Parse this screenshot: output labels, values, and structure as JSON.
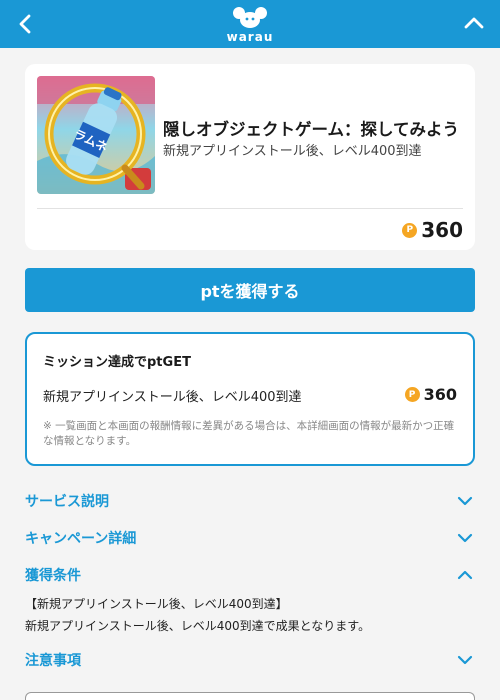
{
  "header": {
    "logo_text": "warau",
    "back_icon": "chevron-left-icon",
    "collapse_icon": "chevron-up-icon",
    "brand_color": "#1a98d5"
  },
  "offer": {
    "title": "隠しオブジェクトゲーム：探してみよう",
    "subtitle": "新規アプリインストール後、レベル400到達",
    "points": "360",
    "coin_symbol": "P",
    "thumbnail_label": "ラムネ"
  },
  "get_button": {
    "label": "ptを獲得する"
  },
  "mission": {
    "title": "ミッション達成でptGET",
    "row_text": "新規アプリインストール後、レベル400到達",
    "points": "360",
    "coin_symbol": "P",
    "note": "※ 一覧画面と本画面の報酬情報に差異がある場合は、本詳細画面の情報が最新かつ正確な情報となります。"
  },
  "accordion": {
    "service": {
      "label": "サービス説明",
      "state": "collapsed"
    },
    "campaign": {
      "label": "キャンペーン詳細",
      "state": "collapsed"
    },
    "conditions": {
      "label": "獲得条件",
      "state": "expanded",
      "line1": "【新規アプリインストール後、レベル400到達】",
      "line2": "新規アプリインストール後、レベル400到達で成果となります。"
    },
    "notes": {
      "label": "注意事項",
      "state": "collapsed"
    }
  }
}
